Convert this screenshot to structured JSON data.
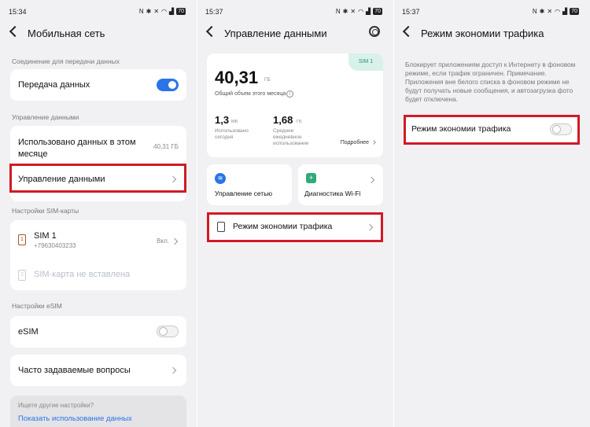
{
  "screens": [
    {
      "status": {
        "time": "15:34",
        "battery": "70"
      },
      "title": "Мобильная сеть",
      "section_connection": "Соединение для передачи данных",
      "data_transfer_label": "Передача данных",
      "data_transfer_on": true,
      "section_data_management": "Управление данными",
      "data_used_label": "Использовано данных в этом месяце",
      "data_used_value": "40,31 ГБ",
      "data_management_label": "Управление данными",
      "section_sim": "Настройки SIM-карты",
      "sim1": {
        "name": "SIM 1",
        "number": "+79630403233",
        "state": "Вкл."
      },
      "sim2_label": "SIM-карта не вставлена",
      "section_esim": "Настройки eSIM",
      "esim_label": "eSIM",
      "esim_on": false,
      "faq_label": "Часто задаваемые вопросы",
      "footer": {
        "question": "Ищете другие настройки?",
        "link": "Показать использование данных"
      }
    },
    {
      "status": {
        "time": "15:37",
        "battery": "70"
      },
      "title": "Управление данными",
      "summary": {
        "sim_badge": "SIM 1",
        "total_value": "40,31",
        "total_unit": "ГБ",
        "total_caption": "Общий объем этого месяца",
        "today_value": "1,3",
        "today_unit": "МБ",
        "today_caption": "Использовано сегодня",
        "daily_value": "1,68",
        "daily_unit": "ГБ",
        "daily_caption": "Среднее ежедневное использование",
        "more_label": "Подробнее"
      },
      "tiles": {
        "network": "Управление сетью",
        "wifi": "Диагностика Wi-Fi"
      },
      "saver_label": "Режим экономии трафика"
    },
    {
      "status": {
        "time": "15:37",
        "battery": "70"
      },
      "title": "Режим экономии трафика",
      "description": "Блокирует приложениям доступ к Интернету в фоновом режиме, если трафик ограничен. Примечание. Приложения вне белого списка в фоновом режиме не будут получать новые сообщения, и автозагрузка фото будет отключена.",
      "saver_label": "Режим экономии трафика",
      "saver_on": false
    }
  ],
  "colors": {
    "accent": "#2a74e8",
    "highlight": "#d11a25",
    "sim_badge": "#4fc1a3"
  },
  "icons": [
    "back-arrow-icon",
    "settings-gear-icon",
    "chevron-right-icon",
    "sim-card-icon",
    "wifi-icon",
    "wifi-diagnostics-icon",
    "document-icon",
    "info-icon"
  ]
}
